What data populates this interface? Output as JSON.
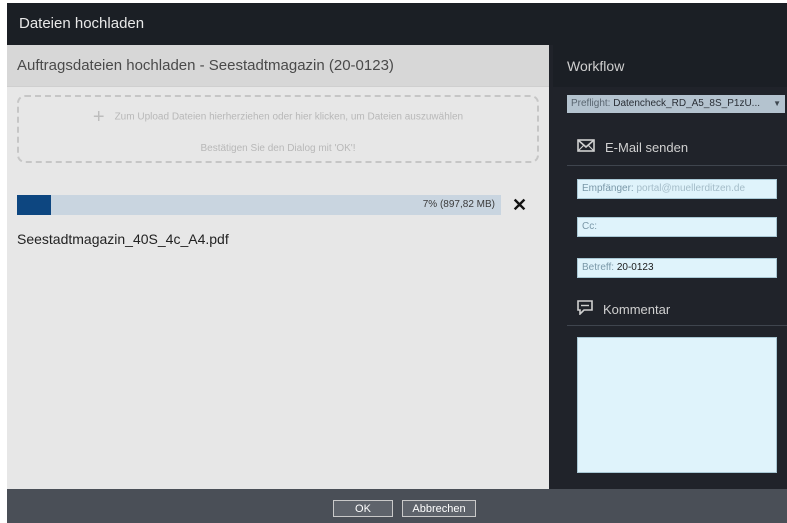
{
  "window": {
    "title": "Dateien hochladen"
  },
  "upload": {
    "header": "Auftragsdateien hochladen - Seestadtmagazin (20-0123)",
    "dropzone_line1": "Zum Upload Dateien hierherziehen oder hier klicken, um Dateien auszuwählen",
    "dropzone_line2": "Bestätigen Sie den Dialog mit 'OK'!",
    "file": {
      "name": "Seestadtmagazin_40S_4c_A4.pdf",
      "progress_percent": 7,
      "progress_text": "7% (897,82 MB)"
    }
  },
  "workflow": {
    "title": "Workflow",
    "preflight_label": "Preflight:",
    "preflight_value": "Datencheck_RD_A5_8S_P1zU...",
    "email_section": "E-Mail senden",
    "recipient_label": "Empfänger:",
    "recipient_value": "portal@muellerditzen.de",
    "cc_label": "Cc:",
    "cc_value": "",
    "subject_label": "Betreff:",
    "subject_value": "20-0123",
    "comment_section": "Kommentar"
  },
  "footer": {
    "ok_label": "OK",
    "cancel_label": "Abbrechen"
  },
  "colors": {
    "accent": "#0d4680",
    "progress_track": "#c9d5e0",
    "field_bg": "#dff3fb",
    "dark_bg": "#20232a"
  },
  "icons": {
    "add": "plus-icon",
    "remove": "close-icon",
    "email": "envelope-icon",
    "comment": "comment-icon",
    "dropdown": "caret-down-icon"
  }
}
